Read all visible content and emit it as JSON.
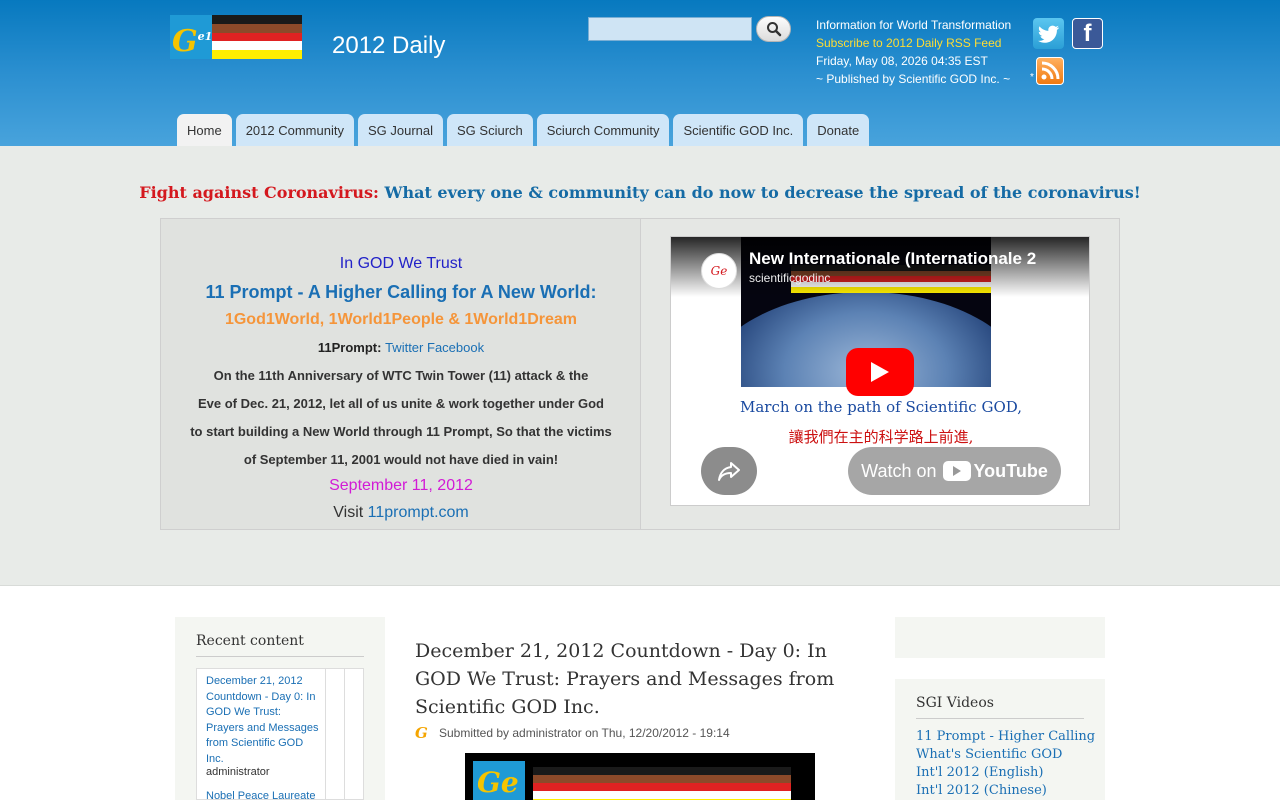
{
  "header": {
    "site_name": "2012 Daily",
    "info_line": "Information for World Transformation",
    "rss_link": "Subscribe to 2012 Daily RSS Feed",
    "date_line": "Friday, May 08, 2026 04:35 EST",
    "publisher_line": "~ Published by Scientific GOD Inc. ~",
    "rss_star": "*",
    "facebook_glyph": "f",
    "logo_glyph": "G",
    "logo_sup": "e10"
  },
  "colors": {
    "header_blue": "#0779bf",
    "flag_stripes": [
      "#1a1a1a",
      "#8c4a2a",
      "#e02222",
      "#ffffff",
      "#ffee00"
    ]
  },
  "search": {
    "placeholder": ""
  },
  "nav": {
    "tabs": [
      {
        "label": "Home",
        "active": true
      },
      {
        "label": "2012 Community"
      },
      {
        "label": "SG Journal"
      },
      {
        "label": "SG Sciurch"
      },
      {
        "label": "Sciurch Community"
      },
      {
        "label": "Scientific GOD Inc."
      },
      {
        "label": "Donate"
      }
    ]
  },
  "banner": {
    "red": "Fight against Coronavirus:",
    "blue": " What every one & community can do now to decrease the spread of the coronavirus!"
  },
  "promo": {
    "trust": "In GOD We Trust",
    "heading": "11 Prompt - A Higher Calling for A New World:",
    "world": "1God1World, 1World1People & 1World1Dream",
    "prompt_prefix": "11Prompt: ",
    "twitter": "Twitter",
    "facebook": "Facebook",
    "para1": "On the 11th Anniversary of WTC Twin Tower (11) attack & the",
    "para2": "Eve of Dec. 21, 2012, let all of us unite & work together under God",
    "para3": "to start building a New World through 11 Prompt, So that the victims",
    "para4": "of September 11, 2001 would not have died in vain!",
    "date": "September 11, 2012",
    "visit_prefix": "Visit ",
    "visit_link": "11prompt.com"
  },
  "video": {
    "title": "New Internationale (Internationale 2",
    "channel": "scientificgodinc",
    "avatar_glyph": "Ge",
    "caption_en": "March on the path of Scientific GOD,",
    "caption_zh": "讓我們在主的科学路上前進,",
    "watch_on": "Watch on",
    "youtube": "YouTube"
  },
  "recent": {
    "title": "Recent content",
    "item1": "December 21, 2012 Countdown - Day 0: In GOD We Trust: Prayers and Messages from Scientific GOD Inc.",
    "author1": "administrator",
    "item2": "Nobel Peace Laureate"
  },
  "node": {
    "title": "December 21, 2012 Countdown - Day 0: In GOD We Trust: Prayers and Messages from Scientific GOD Inc.",
    "submitted": "Submitted by administrator on Thu, 12/20/2012 - 19:14",
    "mini_logo": "G"
  },
  "videos_block": {
    "title": "SGI Videos",
    "items": [
      "11 Prompt - Higher Calling",
      "What's Scientific GOD",
      "Int'l 2012 (English)",
      "Int'l 2012 (Chinese)"
    ]
  }
}
